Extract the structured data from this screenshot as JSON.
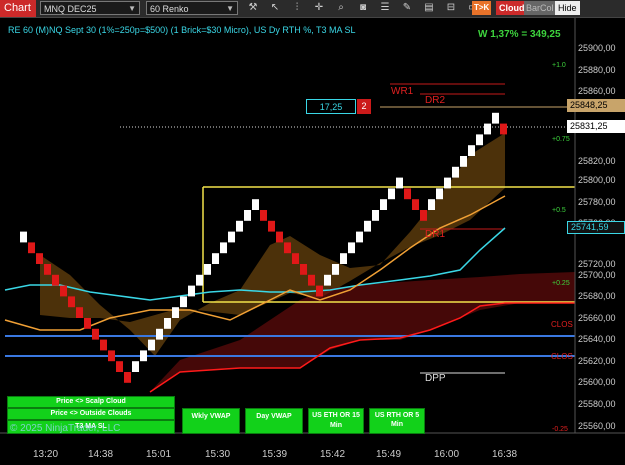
{
  "toolbar": {
    "tab": "Chart",
    "instrument": "MNQ DEC25",
    "bar_type": "60 Renko",
    "tools": [
      "wrench-icon",
      "cursor-icon",
      "bars-icon",
      "crosshair-icon",
      "zoom-icon",
      "camera-icon",
      "properties-icon",
      "draw-icon",
      "templates-icon",
      "lock-icon",
      "box-icon"
    ],
    "tk_label": "T>K",
    "cloud_label": "Cloud",
    "barcol_label": "BarCol",
    "hide_label": "Hide"
  },
  "header": {
    "title": "RE 60 (M)NQ Sept 30 (1%=250p=$500) (1 Brick=$30 Micro), US Dy RTH %, T3 MA SL",
    "stat": "W 1,37% = 349,25"
  },
  "position_box": {
    "qty": "17,25",
    "count": "2"
  },
  "price_axis": {
    "ticks": [
      "25900,00",
      "25880,00",
      "25860,00",
      "25820,00",
      "25800,00",
      "25780,00",
      "25760,00",
      "25720,00",
      "25700,00",
      "25680,00",
      "25660,00",
      "25640,00",
      "25620,00",
      "25600,00",
      "25580,00",
      "25560,00"
    ],
    "markers": [
      {
        "label": "25848,25",
        "bg": "#c8a46a",
        "fg": "#000000"
      },
      {
        "label": "25831,25",
        "bg": "#ffffff",
        "fg": "#000000"
      },
      {
        "label": "25741,59",
        "bg": "#111111",
        "fg": "#3ad7e6"
      }
    ]
  },
  "time_axis": [
    "13:20",
    "14:38",
    "15:01",
    "15:30",
    "15:39",
    "15:42",
    "15:49",
    "16:00",
    "16:38"
  ],
  "percent_labels": [
    "+1.0",
    "+0.75",
    "+0.5",
    "+0.25",
    "-0.25"
  ],
  "levels": {
    "wr1": "WR1",
    "dr2": "DR2",
    "dr1": "DR1",
    "dpp": "DPP",
    "clos1": "CLOS",
    "clos2": "CLOS"
  },
  "buttons": {
    "scalp": "Price <> Scalp Cloud",
    "outside": "Price <> Outside Clouds",
    "t3": "T3 MA SL",
    "wkly": "Wkly VWAP",
    "day": "Day VWAP",
    "eth": "US ETH OR 15 Min",
    "rth": "US RTH OR 5 Min"
  },
  "copyright": "© 2025 NinjaTrader, LLC",
  "colors": {
    "up": "#ffffff",
    "down": "#e01818",
    "cyan": "#3ad7e6",
    "orange": "#f0a035",
    "yellow": "#f2e24a",
    "blue": "#3a78e0",
    "red_line": "#ff1a1a",
    "green_text": "#3dd33d",
    "button_green": "#12d11a"
  },
  "chart_data": {
    "type": "candlestick",
    "bricks": [
      {
        "d": "up",
        "lo": 25720,
        "hi": 25730
      },
      {
        "d": "down",
        "lo": 25710,
        "hi": 25720
      },
      {
        "d": "down",
        "lo": 25700,
        "hi": 25710
      },
      {
        "d": "down",
        "lo": 25690,
        "hi": 25700
      },
      {
        "d": "down",
        "lo": 25680,
        "hi": 25690
      },
      {
        "d": "down",
        "lo": 25670,
        "hi": 25680
      },
      {
        "d": "down",
        "lo": 25660,
        "hi": 25670
      },
      {
        "d": "down",
        "lo": 25650,
        "hi": 25660
      },
      {
        "d": "down",
        "lo": 25640,
        "hi": 25650
      },
      {
        "d": "down",
        "lo": 25630,
        "hi": 25640
      },
      {
        "d": "down",
        "lo": 25620,
        "hi": 25630
      },
      {
        "d": "down",
        "lo": 25610,
        "hi": 25620
      },
      {
        "d": "down",
        "lo": 25600,
        "hi": 25610
      },
      {
        "d": "down",
        "lo": 25590,
        "hi": 25600
      },
      {
        "d": "up",
        "lo": 25600,
        "hi": 25610
      },
      {
        "d": "up",
        "lo": 25610,
        "hi": 25620
      },
      {
        "d": "up",
        "lo": 25620,
        "hi": 25630
      },
      {
        "d": "up",
        "lo": 25630,
        "hi": 25640
      },
      {
        "d": "up",
        "lo": 25640,
        "hi": 25650
      },
      {
        "d": "up",
        "lo": 25650,
        "hi": 25660
      },
      {
        "d": "up",
        "lo": 25660,
        "hi": 25670
      },
      {
        "d": "up",
        "lo": 25670,
        "hi": 25680
      },
      {
        "d": "up",
        "lo": 25680,
        "hi": 25690
      },
      {
        "d": "up",
        "lo": 25690,
        "hi": 25700
      },
      {
        "d": "up",
        "lo": 25700,
        "hi": 25710
      },
      {
        "d": "up",
        "lo": 25710,
        "hi": 25720
      },
      {
        "d": "up",
        "lo": 25720,
        "hi": 25730
      },
      {
        "d": "up",
        "lo": 25730,
        "hi": 25740
      },
      {
        "d": "up",
        "lo": 25740,
        "hi": 25750
      },
      {
        "d": "up",
        "lo": 25750,
        "hi": 25760
      },
      {
        "d": "down",
        "lo": 25740,
        "hi": 25750
      },
      {
        "d": "down",
        "lo": 25730,
        "hi": 25740
      },
      {
        "d": "down",
        "lo": 25720,
        "hi": 25730
      },
      {
        "d": "down",
        "lo": 25710,
        "hi": 25720
      },
      {
        "d": "down",
        "lo": 25700,
        "hi": 25710
      },
      {
        "d": "down",
        "lo": 25690,
        "hi": 25700
      },
      {
        "d": "down",
        "lo": 25680,
        "hi": 25690
      },
      {
        "d": "down",
        "lo": 25670,
        "hi": 25680
      },
      {
        "d": "up",
        "lo": 25680,
        "hi": 25690
      },
      {
        "d": "up",
        "lo": 25690,
        "hi": 25700
      },
      {
        "d": "up",
        "lo": 25700,
        "hi": 25710
      },
      {
        "d": "up",
        "lo": 25710,
        "hi": 25720
      },
      {
        "d": "up",
        "lo": 25720,
        "hi": 25730
      },
      {
        "d": "up",
        "lo": 25730,
        "hi": 25740
      },
      {
        "d": "up",
        "lo": 25740,
        "hi": 25750
      },
      {
        "d": "up",
        "lo": 25750,
        "hi": 25760
      },
      {
        "d": "up",
        "lo": 25760,
        "hi": 25770
      },
      {
        "d": "up",
        "lo": 25770,
        "hi": 25780
      },
      {
        "d": "down",
        "lo": 25760,
        "hi": 25770
      },
      {
        "d": "down",
        "lo": 25750,
        "hi": 25760
      },
      {
        "d": "down",
        "lo": 25740,
        "hi": 25750
      },
      {
        "d": "up",
        "lo": 25750,
        "hi": 25760
      },
      {
        "d": "up",
        "lo": 25760,
        "hi": 25770
      },
      {
        "d": "up",
        "lo": 25770,
        "hi": 25780
      },
      {
        "d": "up",
        "lo": 25780,
        "hi": 25790
      },
      {
        "d": "up",
        "lo": 25790,
        "hi": 25800
      },
      {
        "d": "up",
        "lo": 25800,
        "hi": 25810
      },
      {
        "d": "up",
        "lo": 25810,
        "hi": 25820
      },
      {
        "d": "up",
        "lo": 25820,
        "hi": 25830
      },
      {
        "d": "up",
        "lo": 25830,
        "hi": 25840
      },
      {
        "d": "down",
        "lo": 25820,
        "hi": 25830
      }
    ],
    "lines": {
      "dr1_level": 25740,
      "yellow_upper": 25775,
      "yellow_lower": 25676,
      "blue1": 25655,
      "blue2": 25632,
      "dotted_last": 25831.25
    }
  }
}
